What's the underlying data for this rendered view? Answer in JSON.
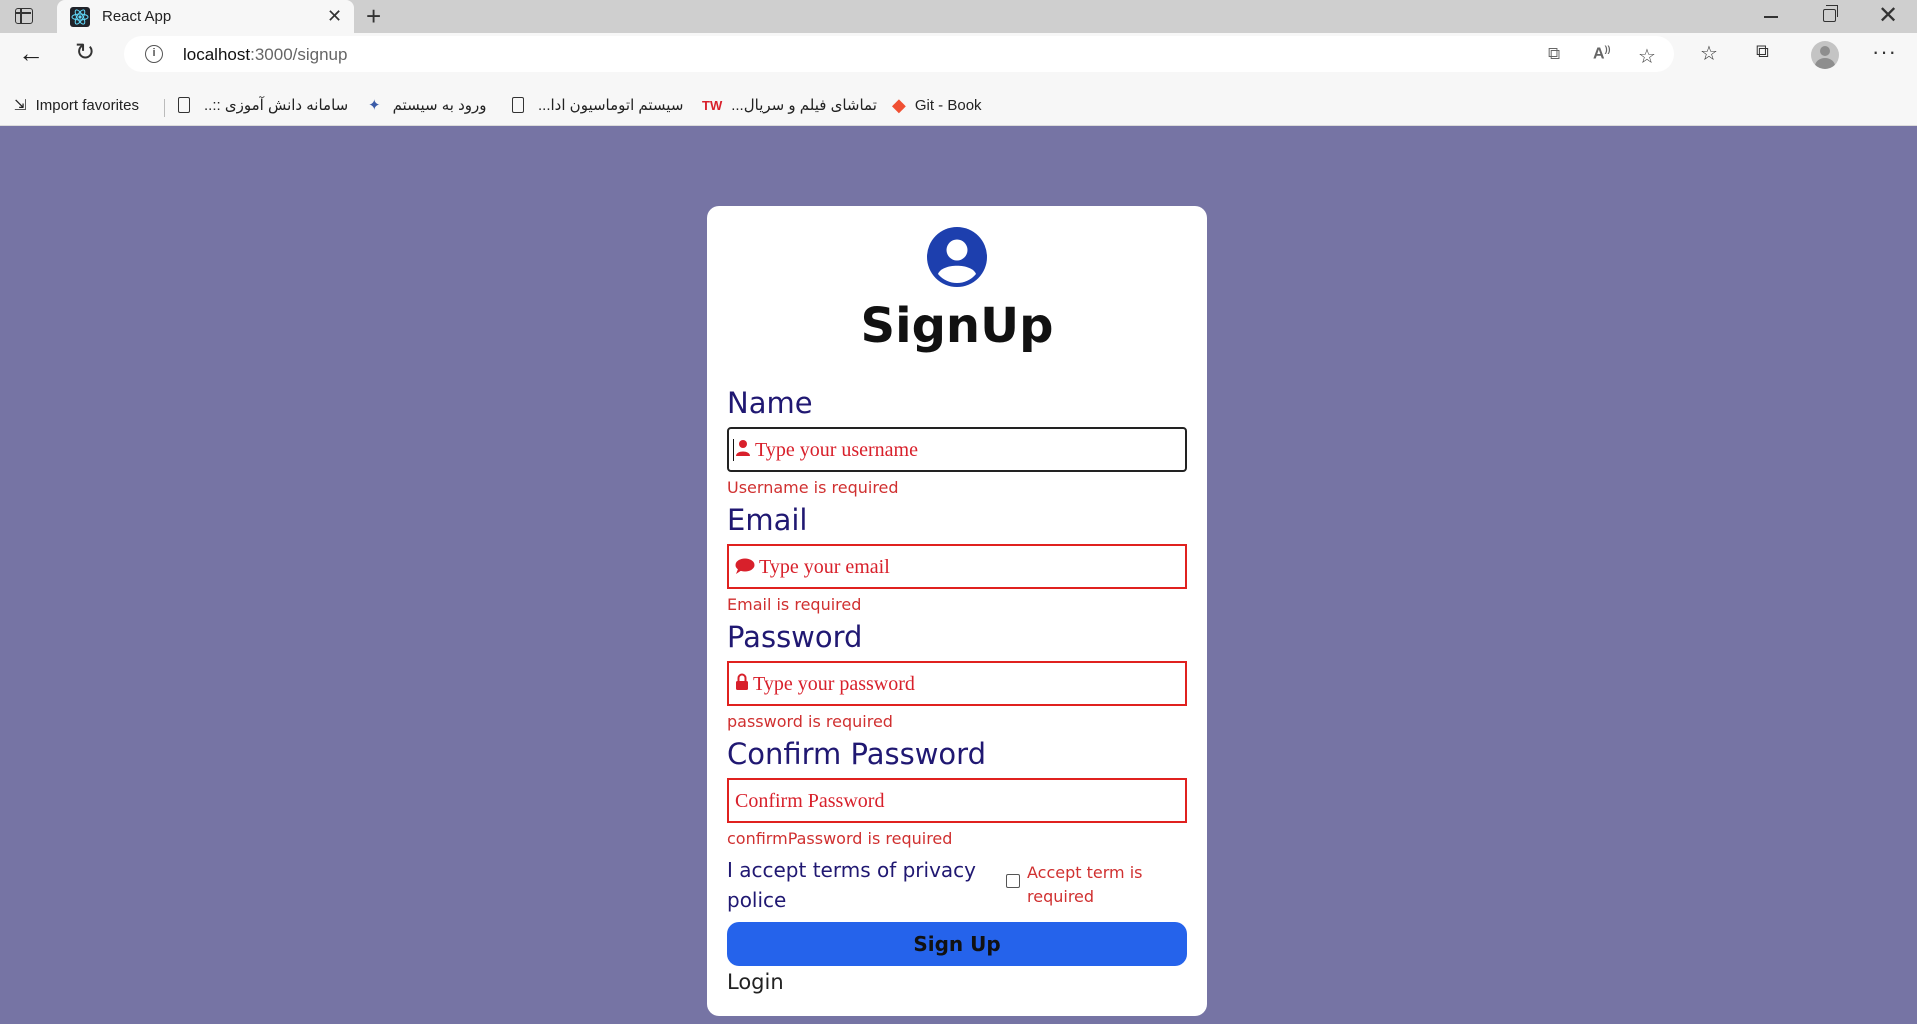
{
  "browser": {
    "tab_title": "React App",
    "tab_close_glyph": "✕",
    "new_tab_glyph": "+",
    "url_host": "localhost",
    "url_path": ":3000/signup",
    "icons": [
      "tab-actions-icon",
      "react-icon",
      "back-icon",
      "reload-icon",
      "info-icon",
      "open-app-icon",
      "read-aloud-icon",
      "add-favorite-icon",
      "favorites-icon",
      "collections-icon",
      "profile-icon",
      "more-icon"
    ]
  },
  "bookmarks": [
    {
      "label": "Import favorites"
    },
    {
      "label": "سامانه دانش آموزی ::.."
    },
    {
      "label": "ورود به سیستم"
    },
    {
      "label": "سیستم اتوماسیون ادا..."
    },
    {
      "label": "تماشای فیلم و سریال..."
    },
    {
      "label": "Git - Book"
    }
  ],
  "form": {
    "title": "SignUp",
    "name": {
      "label": "Name",
      "placeholder": "Type your username",
      "error": "Username is required"
    },
    "email": {
      "label": "Email",
      "placeholder": "Type your email",
      "error": "Email is required"
    },
    "password": {
      "label": "Password",
      "placeholder": "Type your password",
      "error": "password is required"
    },
    "confirm": {
      "label": "Confirm Password",
      "placeholder": "Confirm Password",
      "error": "confirmPassword is required"
    },
    "terms_label": "I accept terms of privacy police",
    "terms_error": "Accept term is required",
    "terms_checked": false,
    "submit_label": "Sign Up",
    "login_link": "Login"
  },
  "colors": {
    "page_background": "#7674a4",
    "accent_blue": "#2563eb",
    "error_red": "#d8202b",
    "label_navy": "#201872",
    "icon_blue": "#1d3fae"
  }
}
